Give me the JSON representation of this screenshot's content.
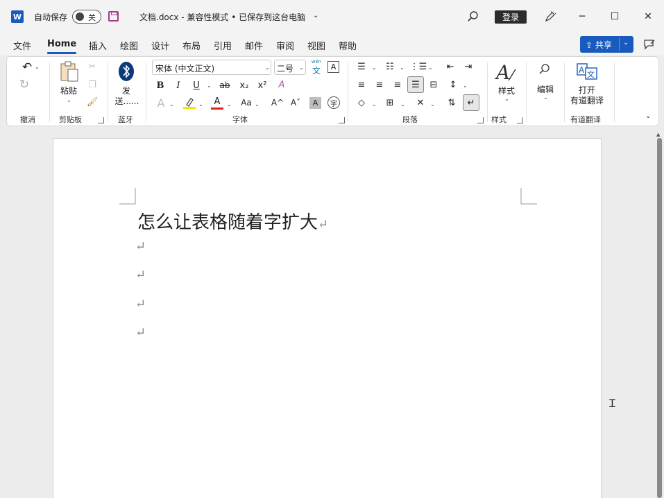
{
  "titlebar": {
    "app_icon_letter": "W",
    "autosave_label": "自动保存",
    "autosave_state": "关",
    "doc_title": "文档.docx  -  兼容性模式 • 已保存到这台电脑",
    "title_caret": "⌄",
    "login_label": "登录",
    "minimize": "─",
    "maximize": "☐",
    "close": "✕"
  },
  "menu": {
    "items": [
      "文件",
      "Home",
      "插入",
      "绘图",
      "设计",
      "布局",
      "引用",
      "邮件",
      "审阅",
      "视图",
      "帮助"
    ],
    "active": "Home",
    "share_label": "共享",
    "share_dd": "⌄"
  },
  "ribbon": {
    "groups": {
      "undo": "撤消",
      "clipboard": "剪贴板",
      "bluetooth": "蓝牙",
      "font": "字体",
      "paragraph": "段落",
      "styles": "样式",
      "youdao": "有道翻译"
    },
    "paste_label": "粘贴",
    "send_label_1": "发",
    "send_label_2": "送......",
    "font_name": "宋体 (中文正文)",
    "font_size": "二号",
    "styles_label": "样式",
    "edit_label": "编辑",
    "open_label_1": "打开",
    "open_label_2": "有道翻译",
    "bold": "B",
    "italic": "I",
    "underline": "U",
    "strike": "ab",
    "subscript": "x₂",
    "superscript": "x²",
    "font_color": "A",
    "case": "Aa",
    "grow": "A^",
    "shrink": "Aˇ",
    "phonetic": "文",
    "phonetic_top": "wén",
    "char_border": "A",
    "dropdown": "⌄"
  },
  "document": {
    "heading": "怎么让表格随着字扩大",
    "para_mark": "↵"
  },
  "colors": {
    "accent": "#185abd",
    "highlight_yellow": "#f5e600",
    "font_red": "#e0201b"
  }
}
